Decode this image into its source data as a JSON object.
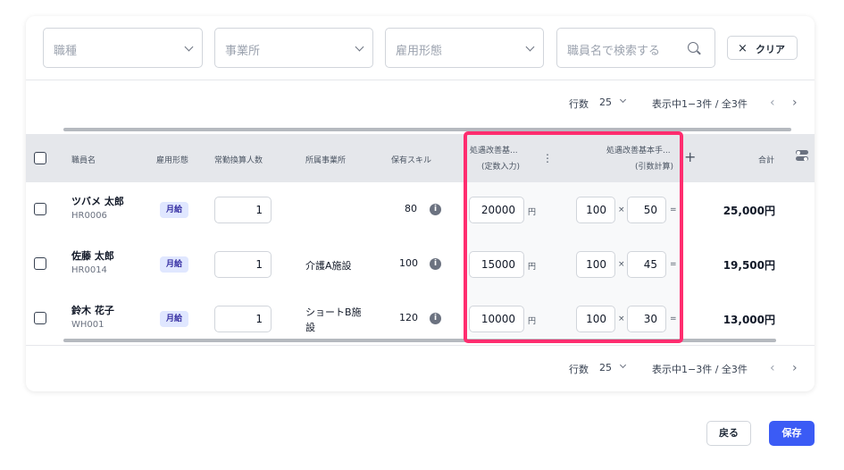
{
  "filters": {
    "job_type_placeholder": "職種",
    "office_placeholder": "事業所",
    "employment_type_placeholder": "雇用形態",
    "search_placeholder": "職員名で検索する",
    "clear_label": "クリア"
  },
  "pager_top": {
    "rows_label": "行数",
    "rows_value": "25",
    "range_text": "表示中1−3件 / 全3件",
    "prev": "‹",
    "next": "›"
  },
  "pager_bottom": {
    "rows_label": "行数",
    "rows_value": "25",
    "range_text": "表示中1−3件 / 全3件",
    "prev": "‹",
    "next": "›"
  },
  "table": {
    "headers": {
      "name": "職員名",
      "employment_type": "雇用形態",
      "fte": "常勤換算人数",
      "office": "所属事業所",
      "skill": "保有スキル",
      "improve_base_line1": "処遇改善基...",
      "improve_base_line2": "(定数入力)",
      "improve_base_calc_line1": "処遇改善基本手...",
      "improve_base_calc_line2": "(引数計算)",
      "total": "合計"
    },
    "rows": [
      {
        "name": "ツバメ 太郎",
        "code": "HR0006",
        "employment": "月給",
        "fte": "1",
        "office": "",
        "skill": "80",
        "fixed_amount": "20000",
        "yen": "円",
        "multiplier_a": "100",
        "times": "×",
        "multiplier_b": "50",
        "equals": "=",
        "total": "25,000円"
      },
      {
        "name": "佐藤 太郎",
        "code": "HR0014",
        "employment": "月給",
        "fte": "1",
        "office": "介護A施設",
        "skill": "100",
        "fixed_amount": "15000",
        "yen": "円",
        "multiplier_a": "100",
        "times": "×",
        "multiplier_b": "45",
        "equals": "=",
        "total": "19,500円"
      },
      {
        "name": "鈴木 花子",
        "code": "WH001",
        "employment": "月給",
        "fte": "1",
        "office_line1": "ショートB施",
        "office_line2": "設",
        "skill": "120",
        "fixed_amount": "10000",
        "yen": "円",
        "multiplier_a": "100",
        "times": "×",
        "multiplier_b": "30",
        "equals": "=",
        "total": "13,000円"
      }
    ]
  },
  "actions": {
    "back_label": "戻る",
    "save_label": "保存"
  },
  "colors": {
    "highlight": "#ff2d6f",
    "primary": "#3b5bf5",
    "badge_bg": "#e0e7ff"
  },
  "icons": {
    "info": "i",
    "plus": "+",
    "clear": "×",
    "more": "⋮"
  }
}
